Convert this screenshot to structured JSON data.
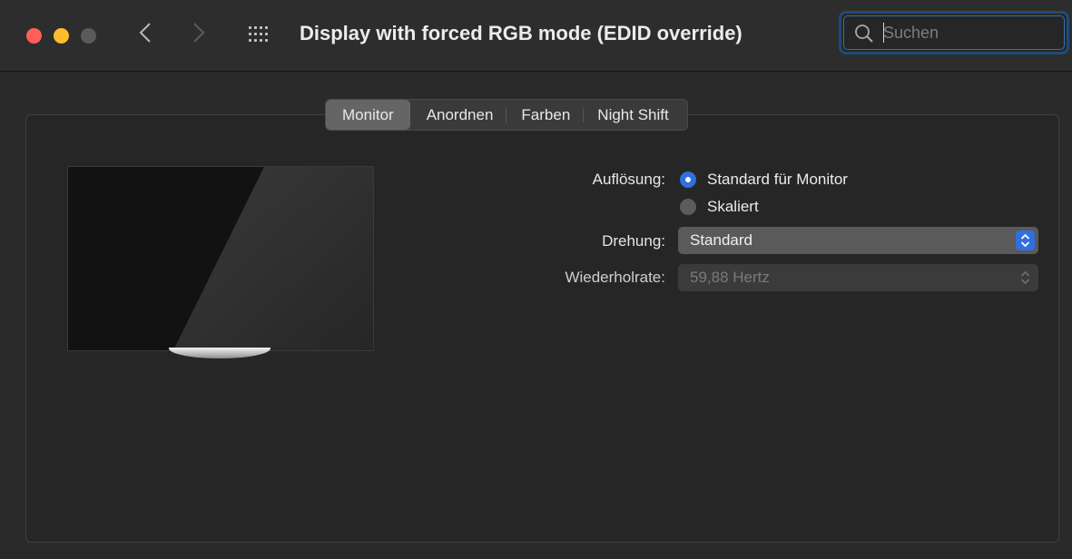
{
  "window": {
    "title": "Display with forced RGB mode (EDID override)",
    "search": {
      "placeholder": "Suchen",
      "value": ""
    }
  },
  "tabs": [
    {
      "label": "Monitor",
      "active": true
    },
    {
      "label": "Anordnen",
      "active": false
    },
    {
      "label": "Farben",
      "active": false
    },
    {
      "label": "Night Shift",
      "active": false
    }
  ],
  "settings": {
    "resolution_label": "Auflösung:",
    "resolution_options": [
      {
        "label": "Standard für Monitor",
        "selected": true
      },
      {
        "label": "Skaliert",
        "selected": false
      }
    ],
    "rotation_label": "Drehung:",
    "rotation_value": "Standard",
    "refresh_label": "Wiederholrate:",
    "refresh_value": "59,88 Hertz",
    "refresh_enabled": false
  },
  "icons": {
    "close": "traffic-light-close",
    "minimize": "traffic-light-minimize",
    "zoom": "traffic-light-zoom-disabled",
    "back": "chevron-left-icon",
    "forward": "chevron-right-icon",
    "all_prefs": "grid-icon",
    "search": "magnifier-icon",
    "stepper": "up-down-chevron-icon"
  },
  "colors": {
    "accent": "#2f6fe0",
    "close": "#ff5f57",
    "minimize": "#febc2e",
    "search_focus_ring": "#1d4b7d"
  }
}
